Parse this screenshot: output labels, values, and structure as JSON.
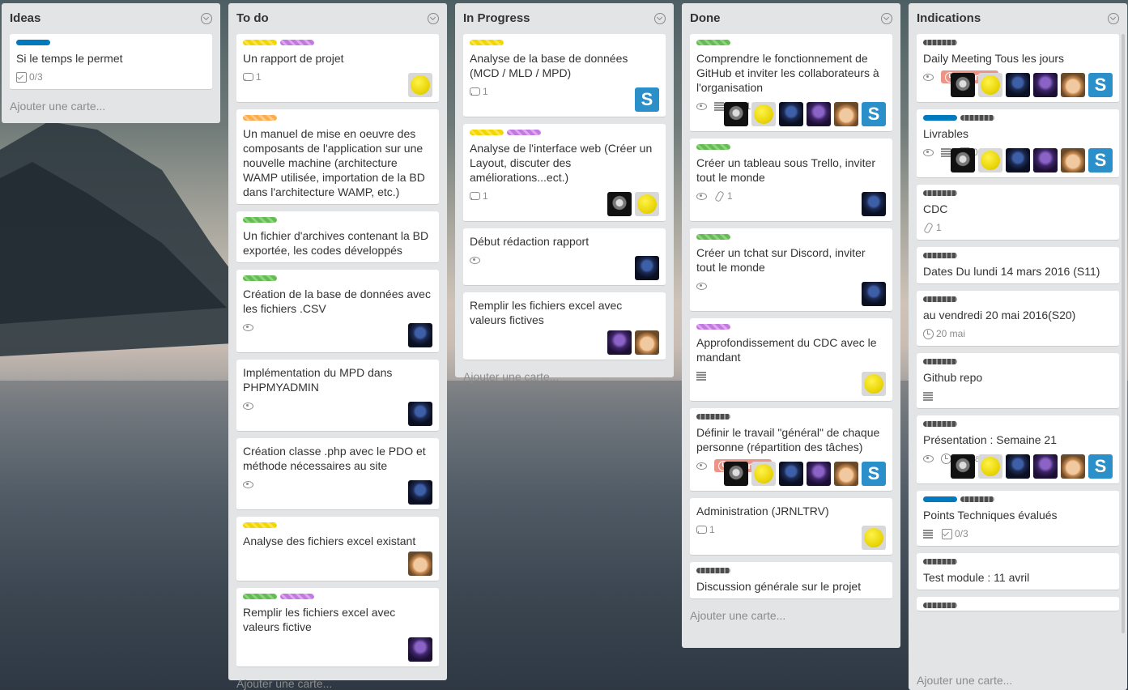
{
  "lists": [
    {
      "title": "Ideas",
      "add_label": "Ajouter une carte...",
      "cards": [
        {
          "labels": [
            "blue"
          ],
          "title": "Si le temps le permet",
          "badges": [
            {
              "icon": "checklist-icon",
              "text": "0/3"
            }
          ],
          "members": []
        }
      ]
    },
    {
      "title": "To do",
      "add_label": "Ajouter une carte...",
      "cards": [
        {
          "labels": [
            "yellow",
            "purple"
          ],
          "title": "Un rapport de projet",
          "badges": [
            {
              "icon": "comment-icon",
              "text": "1"
            }
          ],
          "members": [
            "yellow"
          ]
        },
        {
          "labels": [
            "orange"
          ],
          "title": "Un manuel de mise en oeuvre des composants de l'application sur une nouvelle machine (architecture WAMP utilisée, importation de la BD dans l'architecture WAMP, etc.)",
          "badges": [],
          "members": []
        },
        {
          "labels": [
            "green"
          ],
          "title": "Un fichier d'archives contenant la BD exportée, les codes développés",
          "badges": [],
          "members": []
        },
        {
          "labels": [
            "green"
          ],
          "title": "Création de la base de données avec les fichiers .CSV",
          "badges": [
            {
              "icon": "eye-icon",
              "text": ""
            }
          ],
          "members": [
            "blue"
          ]
        },
        {
          "labels": [],
          "title": "Implémentation du MPD dans PHPMYADMIN",
          "badges": [
            {
              "icon": "eye-icon",
              "text": ""
            }
          ],
          "members": [
            "blue"
          ]
        },
        {
          "labels": [],
          "title": "Création classe .php avec le PDO et méthode nécessaires au site",
          "badges": [
            {
              "icon": "eye-icon",
              "text": ""
            }
          ],
          "members": [
            "blue"
          ]
        },
        {
          "labels": [
            "yellow"
          ],
          "title": "Analyse des fichiers excel existant",
          "badges": [],
          "members": [
            "face"
          ]
        },
        {
          "labels": [
            "green",
            "purple"
          ],
          "title": "Remplir les fichiers excel avec valeurs fictive",
          "badges": [],
          "members": [
            "purple"
          ]
        }
      ]
    },
    {
      "title": "In Progress",
      "add_label": "Ajouter une carte...",
      "cards": [
        {
          "labels": [
            "yellow"
          ],
          "title": "Analyse de la base de données (MCD / MLD / MPD)",
          "badges": [
            {
              "icon": "comment-icon",
              "text": "1"
            }
          ],
          "members": [
            "s"
          ]
        },
        {
          "labels": [
            "yellow",
            "purple"
          ],
          "title": "Analyse de l'interface web (Créer un Layout, discuter des améliorations...ect.)",
          "badges": [
            {
              "icon": "comment-icon",
              "text": "1"
            }
          ],
          "members": [
            "dark",
            "yellow"
          ]
        },
        {
          "labels": [],
          "title": "Début rédaction rapport",
          "badges": [
            {
              "icon": "eye-icon",
              "text": ""
            }
          ],
          "members": [
            "blue"
          ]
        },
        {
          "labels": [],
          "title": "Remplir les fichiers excel avec valeurs fictives",
          "badges": [],
          "members": [
            "purple",
            "face"
          ]
        }
      ]
    },
    {
      "title": "Done",
      "add_label": "Ajouter une carte...",
      "cards": [
        {
          "labels": [
            "green"
          ],
          "title": "Comprendre le fonctionnement de GitHub et inviter les collaborateurs à l'organisation",
          "badges": [
            {
              "icon": "eye-icon",
              "text": ""
            },
            {
              "icon": "description-icon",
              "text": ""
            },
            {
              "icon": "comment-icon",
              "text": "1"
            }
          ],
          "members": [
            "dark",
            "yellow",
            "blue",
            "purple",
            "face",
            "s"
          ]
        },
        {
          "labels": [
            "green"
          ],
          "title": "Créer un tableau sous Trello, inviter tout le monde",
          "badges": [
            {
              "icon": "eye-icon",
              "text": ""
            },
            {
              "icon": "attachment-icon",
              "text": "1"
            }
          ],
          "members": [
            "blue"
          ]
        },
        {
          "labels": [
            "green"
          ],
          "title": "Créer un tchat sur Discord, inviter tout le monde",
          "badges": [
            {
              "icon": "eye-icon",
              "text": ""
            }
          ],
          "members": [
            "blue"
          ]
        },
        {
          "labels": [
            "purple"
          ],
          "title": "Approfondissement du CDC avec le mandant",
          "badges": [
            {
              "icon": "description-icon",
              "text": ""
            }
          ],
          "members": [
            "yellow"
          ]
        },
        {
          "labels": [
            "black"
          ],
          "title": "Définir le travail \"général\" de chaque personne (répartition des tâches)",
          "badges": [
            {
              "icon": "eye-icon",
              "text": ""
            },
            {
              "icon": "due-date",
              "text": "16 mars"
            }
          ],
          "members": [
            "dark",
            "yellow",
            "blue",
            "purple",
            "face",
            "s"
          ]
        },
        {
          "labels": [],
          "title": "Administration (JRNLTRV)",
          "badges": [
            {
              "icon": "comment-icon",
              "text": "1"
            }
          ],
          "members": [
            "yellow"
          ]
        },
        {
          "labels": [
            "black"
          ],
          "title": "Discussion générale sur le projet",
          "badges": [],
          "members": []
        }
      ]
    },
    {
      "title": "Indications",
      "add_label": "Ajouter une carte...",
      "cards": [
        {
          "labels": [
            "black"
          ],
          "title": "Daily Meeting Tous les jours",
          "badges": [
            {
              "icon": "eye-icon",
              "text": ""
            },
            {
              "icon": "due-date",
              "text": "16 mars"
            }
          ],
          "members": [
            "dark",
            "yellow",
            "blue",
            "purple",
            "face",
            "s"
          ]
        },
        {
          "labels": [
            "blue",
            "black"
          ],
          "title": "Livrables",
          "badges": [
            {
              "icon": "eye-icon",
              "text": ""
            },
            {
              "icon": "description-icon",
              "text": ""
            },
            {
              "icon": "checklist-icon",
              "text": "0/5"
            }
          ],
          "members": [
            "dark",
            "yellow",
            "blue",
            "purple",
            "face",
            "s"
          ]
        },
        {
          "labels": [
            "black"
          ],
          "title": "CDC",
          "badges": [
            {
              "icon": "attachment-icon",
              "text": "1"
            }
          ],
          "members": []
        },
        {
          "labels": [
            "black"
          ],
          "title": "Dates Du lundi 14 mars 2016 (S11)",
          "badges": [],
          "members": []
        },
        {
          "labels": [
            "black"
          ],
          "title": "au vendredi 20 mai 2016(S20)",
          "badges": [
            {
              "icon": "clock-icon",
              "text": "20 mai"
            }
          ],
          "members": []
        },
        {
          "labels": [
            "black"
          ],
          "title": "Github repo",
          "badges": [
            {
              "icon": "description-icon",
              "text": ""
            }
          ],
          "members": []
        },
        {
          "labels": [
            "black"
          ],
          "title": "Présentation : Semaine 21",
          "badges": [
            {
              "icon": "eye-icon",
              "text": ""
            },
            {
              "icon": "clock-icon",
              "text": "11 mai"
            }
          ],
          "members": [
            "dark",
            "yellow",
            "blue",
            "purple",
            "face",
            "s"
          ]
        },
        {
          "labels": [
            "blue",
            "black"
          ],
          "title": "Points Techniques évalués",
          "badges": [
            {
              "icon": "description-icon",
              "text": ""
            },
            {
              "icon": "checklist-icon",
              "text": "0/3"
            }
          ],
          "members": []
        },
        {
          "labels": [
            "black"
          ],
          "title": "Test module : 11 avril",
          "badges": [],
          "members": []
        },
        {
          "labels": [
            "black"
          ],
          "title": "",
          "badges": [],
          "members": []
        }
      ]
    }
  ]
}
